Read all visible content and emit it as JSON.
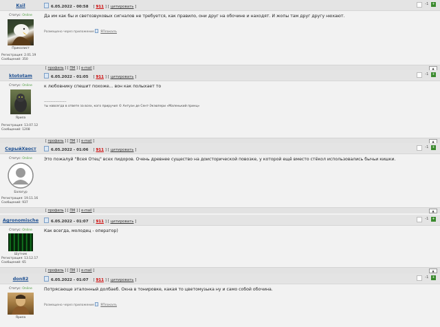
{
  "labels": {
    "status": "Статус:",
    "online": "Online",
    "reg": "Регистрация:",
    "msgs": "Сообщений:",
    "quote": "цитировать",
    "profile": "профиль",
    "pm": "ПМ",
    "email": "e-mail",
    "placed_via": "Размещено через приложение",
    "app_name": "ЯПлакалъ",
    "sep": " | "
  },
  "posts": [
    {
      "username": "Ksil",
      "date": "6.05.2022 - 00:58",
      "post_number": "911",
      "rank": "Приколист",
      "reg_date": "2.01.19",
      "messages": "350",
      "rating": "-1",
      "content": "Да им как бы и светозвуковых сигналов не требуется, как правило, они друг на обочине и находят. И жопы там друг другу нюхают.",
      "signature": ""
    },
    {
      "username": "ktototam",
      "date": "6.05.2022 - 01:05",
      "post_number": "911",
      "rank": "Ярила",
      "reg_date": "13.07.12",
      "messages": "1208",
      "rating": "-1",
      "content": "к любовнику спешит похоже... вон как полыхает то",
      "signature_rule": "--------------------",
      "signature": "ты навсегда в ответе за всех, кого приручил © Антуан де Сент-Экзюпери «Маленький принц»"
    },
    {
      "username": "СерыйХвост",
      "date": "6.05.2022 - 01:06",
      "post_number": "911",
      "rank": "Балагур",
      "reg_date": "19.11.16",
      "messages": "937",
      "rating": "-1",
      "content": "Это пожалуй \"Всея Отец\" всех пидоров. Очень древнее существо на доисторической повозке, у которой ещё вместо стёкол использовались бычьи кишки.",
      "signature": ""
    },
    {
      "username": "Agronomische",
      "date": "6.05.2022 - 01:07",
      "post_number": "911",
      "rank": "Шутник",
      "reg_date": "13.12.17",
      "messages": "65",
      "rating": "-1",
      "content": "Как всегда, молодец - оператор)",
      "signature": ""
    },
    {
      "username": "don82",
      "date": "6.05.2022 - 01:07",
      "post_number": "911",
      "rank": "Ярила",
      "reg_date": "",
      "messages": "",
      "rating": "-1",
      "content": "Потрясающе эталонный долбаеб. Окна в тонировке, какая то цветомузыка ну и само собой обочина.",
      "signature": ""
    }
  ]
}
